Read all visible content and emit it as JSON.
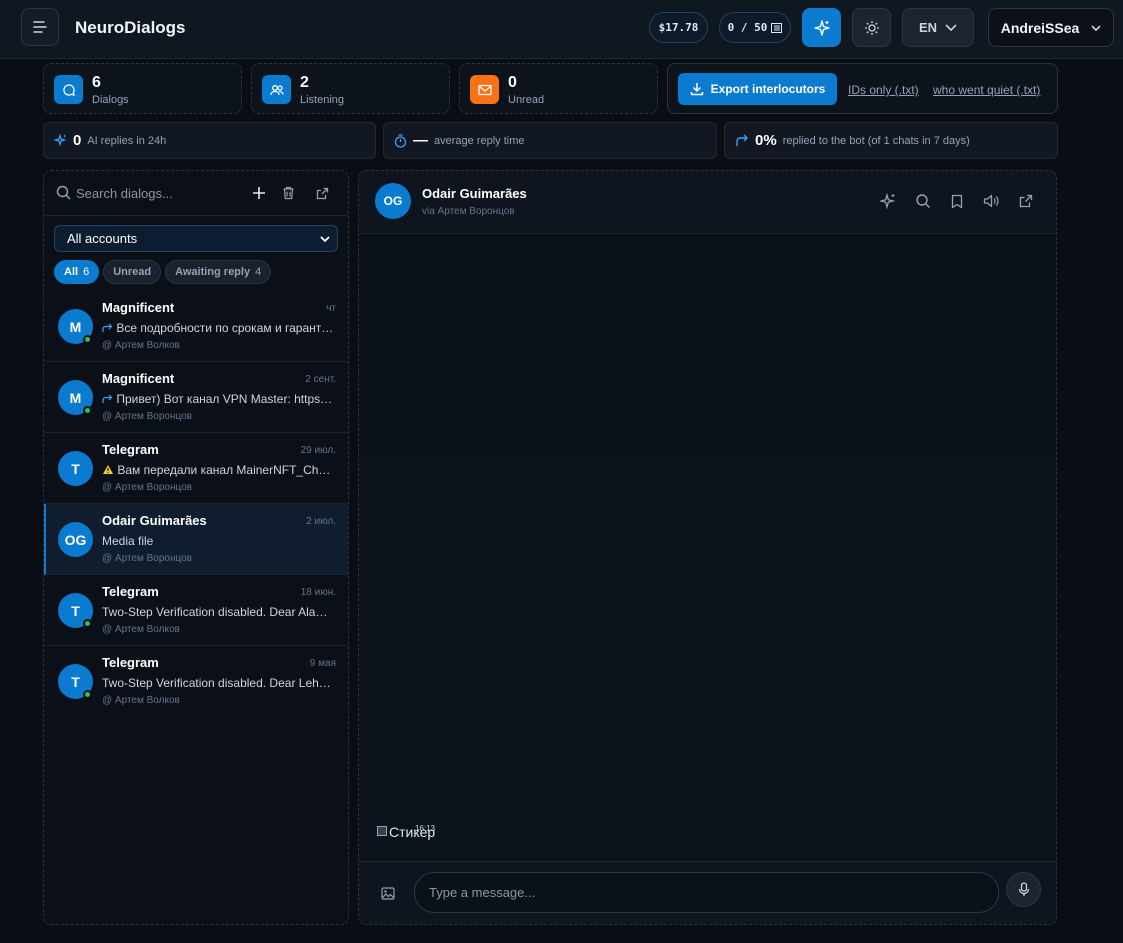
{
  "app": {
    "title": "NeuroDialogs"
  },
  "header": {
    "balance": "$17.78",
    "quota": "0 / 50",
    "language": "EN",
    "user": "AndreiSSea"
  },
  "stats": [
    {
      "value": "6",
      "label": "Dialogs",
      "color": "#0b7bd0"
    },
    {
      "value": "2",
      "label": "Listening",
      "color": "#0b7bd0"
    },
    {
      "value": "0",
      "label": "Unread",
      "color": "#f97316"
    }
  ],
  "export": {
    "button": "Export interlocutors",
    "ids_link": "IDs only (.txt)",
    "quiet_link": "who went quiet (.txt)"
  },
  "metrics": {
    "ai_value": "0",
    "ai_label": "AI replies in 24h",
    "time_value": "—",
    "time_label": "average reply time",
    "reply_value": "0%",
    "reply_label": "replied to the bot (of 1 chats in 7 days)"
  },
  "sidebar": {
    "search_placeholder": "Search dialogs...",
    "account_select": "All accounts",
    "filters": [
      {
        "label": "All",
        "count": "6"
      },
      {
        "label": "Unread",
        "count": ""
      },
      {
        "label": "Awaiting reply",
        "count": "4"
      }
    ],
    "dialogs": [
      {
        "initials": "M",
        "name": "Magnificent",
        "date": "чт",
        "preview": "Все подробности по срокам и гарантиям",
        "icon": "forward",
        "account": "@ Артем Волков",
        "online": true
      },
      {
        "initials": "M",
        "name": "Magnificent",
        "date": "2 сент.",
        "preview": "Привет) Вот канал VPN Master: https://t.me",
        "icon": "forward",
        "account": "@ Артем Воронцов",
        "online": true
      },
      {
        "initials": "T",
        "name": "Telegram",
        "date": "29 июл.",
        "preview": "Вам передали канал MainerNFT_Channel",
        "icon": "warning",
        "account": "@ Артем Воронцов",
        "online": false
      },
      {
        "initials": "OG",
        "name": "Odair Guimarães",
        "date": "2 июл.",
        "preview": "Media file",
        "icon": "",
        "account": "@ Артем Воронцов",
        "online": false
      },
      {
        "initials": "T",
        "name": "Telegram",
        "date": "18 июн.",
        "preview": "Two-Step Verification disabled. Dear AlaOlam",
        "icon": "",
        "account": "@ Артем Волков",
        "online": true
      },
      {
        "initials": "T",
        "name": "Telegram",
        "date": "9 мая",
        "preview": "Two-Step Verification disabled. Dear Lehrman",
        "icon": "",
        "account": "@ Артем Волков",
        "online": true
      }
    ]
  },
  "chat": {
    "initials": "OG",
    "name": "Odair Guimarães",
    "via": "via Артем Воронцов",
    "sticker_alt": "Стикер",
    "sticker_time": "16:13",
    "input_placeholder": "Type a message..."
  }
}
